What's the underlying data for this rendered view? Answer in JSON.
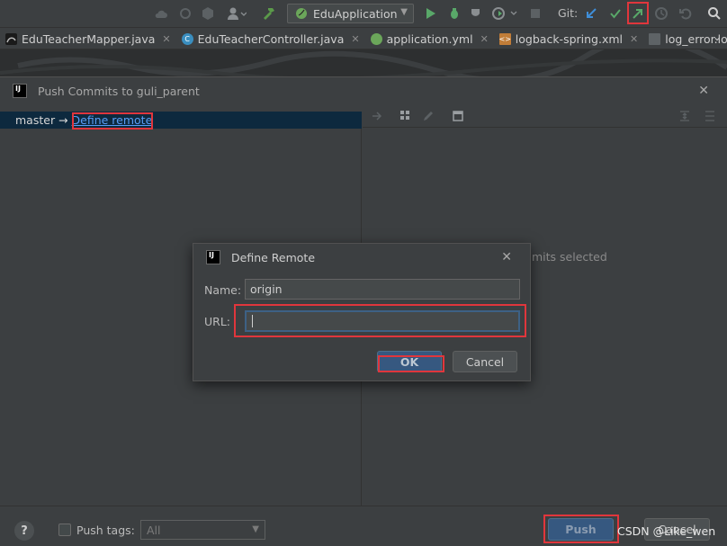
{
  "toolbar": {
    "run_config": "EduApplication",
    "git_label": "Git:",
    "icons": [
      "cloud-icon",
      "sync-icon",
      "hexagon-icon",
      "user-icon",
      "build-hammer-icon",
      "run-icon",
      "debug-icon",
      "coverage-icon",
      "profile-icon",
      "stop-icon",
      "git-update-icon",
      "git-commit-icon",
      "git-push-icon",
      "history-icon",
      "rollback-icon",
      "search-icon"
    ]
  },
  "tabs": [
    {
      "label": "EduTeacherMapper.java",
      "icon": "mybatis-icon"
    },
    {
      "label": "EduTeacherController.java",
      "icon": "java-class-icon"
    },
    {
      "label": "application.yml",
      "icon": "spring-yaml-icon"
    },
    {
      "label": "logback-spring.xml",
      "icon": "xml-icon"
    },
    {
      "label": "log_error.lo",
      "icon": "log-file-icon"
    }
  ],
  "push_dialog": {
    "title": "Push Commits to guli_parent",
    "branch": "master →",
    "define_remote_link": "Define remote",
    "no_commits_text": "mits selected",
    "push_tags_label": "Push tags:",
    "tags_select_value": "All",
    "push_button": "Push",
    "cancel_button": "Cancel",
    "help_label": "?"
  },
  "define_remote": {
    "title": "Define Remote",
    "name_label": "Name:",
    "name_value": "origin",
    "url_label": "URL:",
    "url_value": "",
    "ok_button": "OK",
    "cancel_button": "Cancel"
  },
  "watermark": "CSDN @Like_wen",
  "colors": {
    "accent": "#365880",
    "link": "#589df6",
    "highlight_box": "#e0363c",
    "selected_row": "#0d293e"
  }
}
